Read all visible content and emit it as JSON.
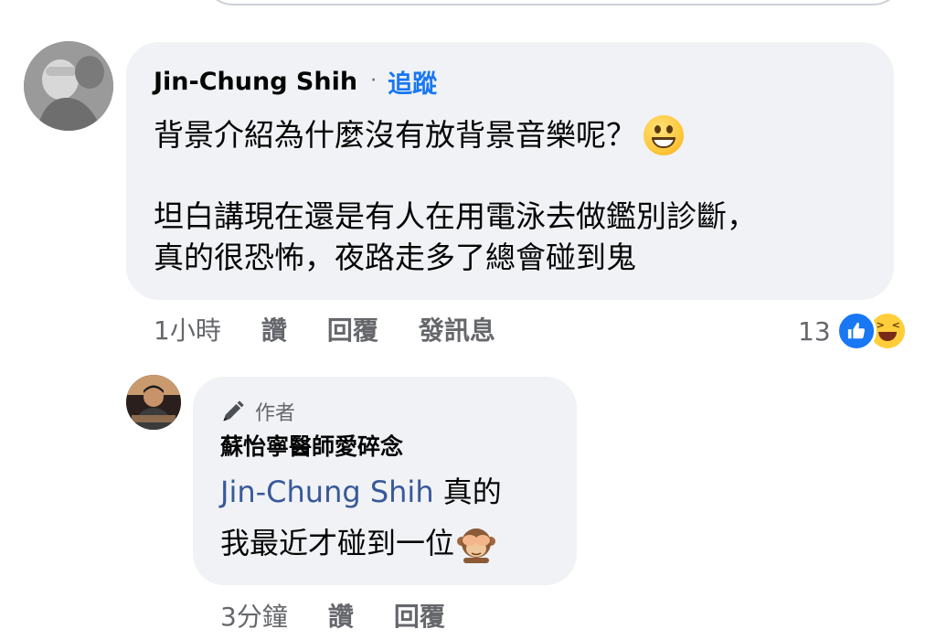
{
  "comment": {
    "author": "Jin-Chung Shih",
    "separator": "·",
    "follow_label": "追蹤",
    "line1": "背景介紹為什麼沒有放背景音樂呢？",
    "line1_emoji": "grinning-face-icon",
    "line2": "坦白講現在還是有人在用電泳去做鑑別診斷，",
    "line3": "真的很恐怖，夜路走多了總會碰到鬼",
    "time": "1小時",
    "like_label": "讚",
    "reply_label": "回覆",
    "message_label": "發訊息",
    "reaction_count": "13",
    "reactions": [
      "like-icon",
      "haha-icon"
    ]
  },
  "reply": {
    "badge_label": "作者",
    "author": "蘇怡寧醫師愛碎念",
    "mention": "Jin-Chung Shih",
    "line1_suffix": " 真的",
    "line2": "我最近才碰到一位",
    "line2_emoji": "see-no-evil-monkey-icon",
    "time": "3分鐘",
    "like_label": "讚",
    "reply_label": "回覆"
  },
  "colors": {
    "bubble_bg": "#f0f2f5",
    "link_blue": "#1877f2",
    "mention_blue": "#385898",
    "meta_gray": "#65676b"
  }
}
